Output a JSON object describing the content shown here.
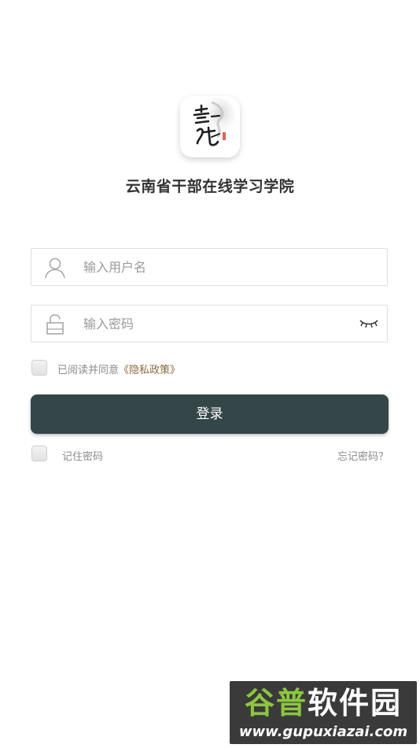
{
  "app": {
    "logo_text": "云线",
    "title": "云南省干部在线学习学院"
  },
  "login_form": {
    "username_placeholder": "输入用户名",
    "password_placeholder": "输入密码",
    "agree_prefix": "已阅读并同意",
    "privacy_link": "《隐私政策》",
    "login_button": "登录",
    "remember_label": "记住密码",
    "forgot_label": "忘记密码？"
  },
  "watermark": {
    "part1": "谷普",
    "part2": "软件园",
    "url": "www.gupuxiazai.com"
  },
  "colors": {
    "primary_button": "#354648",
    "link": "#8a6a3e",
    "muted_text": "#8a8a8a"
  },
  "icons": {
    "username": "user-icon",
    "password": "lock-icon",
    "visibility": "eye-closed-icon"
  }
}
